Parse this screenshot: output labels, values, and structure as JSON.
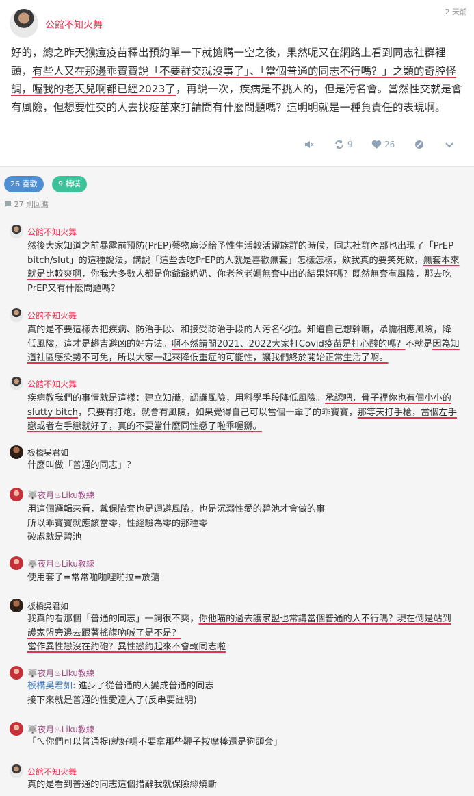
{
  "post": {
    "author": "公館不知火舞",
    "time": "2 天前",
    "body_p1": "好的，總之昨天猴痘疫苗釋出預約單一下就搶購一空之後，果然呢又在網路上看到同志社群裡頭，",
    "body_u1": "有些人又在那邊乖寶寶說「不要群交就沒事了」、「當個普通的同志不行嗎？」之類的奇腔怪調，",
    "body_u2": "喔我的老天兒啊都已經2023了",
    "body_p2": "，再說一次，疾病是不挑人的，但是污名會。當然性交就是會有風險，但想要性交的人去找疫苗來打請問有什麼問題嗎？這明明就是一種負責任的表現啊。",
    "repost_count": "9",
    "like_count": "26"
  },
  "stats": {
    "likes_pill": "26 喜歡",
    "reposts_pill": "9 轉噗",
    "replies_label": "27 則回應"
  },
  "comments": [
    {
      "author": "公館不知火舞",
      "p1": "然後大家知道之前暴露前預防(PrEP)藥物廣泛給予性生活較活躍族群的時候，同志社群內部也出現了「PrEP bitch/slut」的這種說法，講說「這些去吃PrEP的人就是喜歡無套」怎樣怎樣，欸我真的要笑死欸，",
      "u1": "無套本來就是比較爽啊",
      "p2": "，你我大多數人都是你爺爺奶奶、你老爸老媽無套中出的結果好嗎？既然無套有風險，那去吃PrEP又有什麼問題嗎？"
    },
    {
      "author": "公館不知火舞",
      "p1": "真的是不要這樣去把疾病、防治手段、和接受防治手段的人污名化啦。知道自己想幹嘛，承擔相應風險，降低風險，這才是趨吉避凶的好方法。",
      "u1": "啊不然請問2021、2022大家打Covid疫苗是打心酸的嗎？",
      "p2": "不就是",
      "u2": "因為知道社區感染勢不可免，所以大家一起來降低重症的可能性，讓我們終於開始正常生活了啊。"
    },
    {
      "author": "公館不知火舞",
      "p1": "疾病教我們的事情就是這樣：建立知識，認識風險，用科學手段降低風險。",
      "u1": "承認吧，骨子裡你也有個小小的slutty bitch",
      "p2": "，只要有打炮，就會有風險，如果覺得自己可以當個一輩子的乖寶寶，",
      "u2": "那等天打手槍，當個左手戀或者右手戀就好了，真的不要當什麼同性戀了啦乖喔掰。"
    },
    {
      "author": "板橋吳君如",
      "p1": "什麼叫做「普通的同志」？"
    },
    {
      "author": "🐺夜月♨Liku教練",
      "l1": "用這個邏輯來看，戴保險套也是迴避風險，也是沉溺性愛的碧池才會做的事",
      "l2": "所以乖寶寶就應該當零，性經驗為零的那種零",
      "l3": "破處就是碧池"
    },
    {
      "author": "🐺夜月♨Liku教練",
      "p1": "使用套子=常常啪啪哩啪拉=放蕩"
    },
    {
      "author": "板橋吳君如",
      "p1": "我真的看那個「普通的同志」一詞很不爽，",
      "u1": "你他喵的過去護家盟也常講當個普通的人不行嗎？現在倒是站到護家盟旁邊去跟著搖旗吶喊了是不是？",
      "u2": "當作異性戀沒在約砲？異性戀約起來不會輸同志啦"
    },
    {
      "author": "🐺夜月♨Liku教練",
      "mention": "板橋吳君如",
      "p1": ": 進步了從普通的人變成普通的同志",
      "l2": "接下來就是普通的性愛達人了(反串要註明)"
    },
    {
      "author": "🐺夜月♨Liku教練",
      "p1": "「ㄟ你們可以普通捉i就好嗎不要拿那些鞭子按摩棒還是狗頭套」"
    },
    {
      "author": "公館不知火舞",
      "p1": "真的是看到普通的同志這個措辭我就保險絲燒斷"
    }
  ],
  "colors": {
    "accent": "#e5324f",
    "likes_pill": "#4f8fd1",
    "reposts_pill": "#3cc29a",
    "liku_name": "#a24e86",
    "mention": "#3a78b5"
  },
  "icons": [
    "mute-icon",
    "repost-icon",
    "heart-icon",
    "block-icon",
    "chevron-down-icon",
    "speech-bubble-icon"
  ]
}
